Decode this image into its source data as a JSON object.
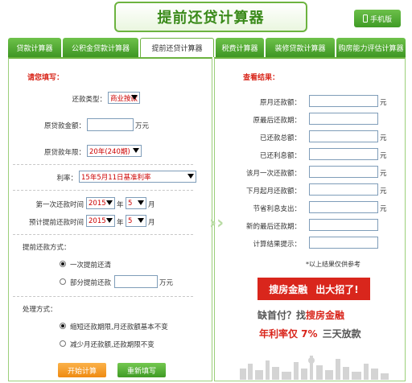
{
  "header": {
    "title": "提前还贷计算器",
    "mobile_label": "手机版"
  },
  "tabs": [
    "贷款计算器",
    "公积金贷款计算器",
    "提前还贷计算器",
    "税费计算器",
    "装修贷款计算器",
    "购房能力评估计算器"
  ],
  "form": {
    "section_title": "请您填写：",
    "loan_type_label": "还款类型：",
    "loan_type_value": "商业按款",
    "amount_label": "原贷款金额：",
    "amount_unit": "万元",
    "years_label": "原贷款年限：",
    "years_value": "20年(240期)",
    "rate_label": "利率：",
    "rate_value": "15年5月11日基准利率",
    "first_pay_label": "第一次还款时间",
    "first_year": "2015",
    "first_month": "5",
    "plan_pay_label": "预计提前还款时间",
    "plan_year": "2015",
    "plan_month": "5",
    "year_unit": "年",
    "month_unit": "月",
    "prepay_title": "提前还款方式：",
    "prepay_opt1": "一次提前还清",
    "prepay_opt2": "部分提前还款",
    "prepay_unit": "万元",
    "handle_title": "处理方式：",
    "handle_opt1": "缩短还款期限,月还款额基本不变",
    "handle_opt2": "减少月还款额,还款期限不变",
    "calc_button": "开始计算",
    "reset_button": "重新填写"
  },
  "results": {
    "title": "查看结果：",
    "rows": [
      {
        "label": "原月还款额：",
        "unit": "元"
      },
      {
        "label": "原最后还款期：",
        "unit": ""
      },
      {
        "label": "已还款总额：",
        "unit": "元"
      },
      {
        "label": "已还利息额：",
        "unit": "元"
      },
      {
        "label": "该月一次还款额：",
        "unit": "元"
      },
      {
        "label": "下月起月还款额：",
        "unit": "元"
      },
      {
        "label": "节省利息支出：",
        "unit": "元"
      },
      {
        "label": "新的最后还款期：",
        "unit": ""
      },
      {
        "label": "计算结果提示：",
        "unit": ""
      }
    ],
    "note": "*以上结果仅供参考"
  },
  "ad": {
    "banner_left": "搜房金融",
    "banner_right": "出大招了!",
    "line1_a": "缺首付？找",
    "line1_b": "搜房金融",
    "line2_a": "年利率仅 7%",
    "line2_b": "三天放款"
  },
  "colors": {
    "brand_green": "#6cb33f",
    "accent_red": "#d9261c",
    "button_orange": "#ef8a12"
  }
}
